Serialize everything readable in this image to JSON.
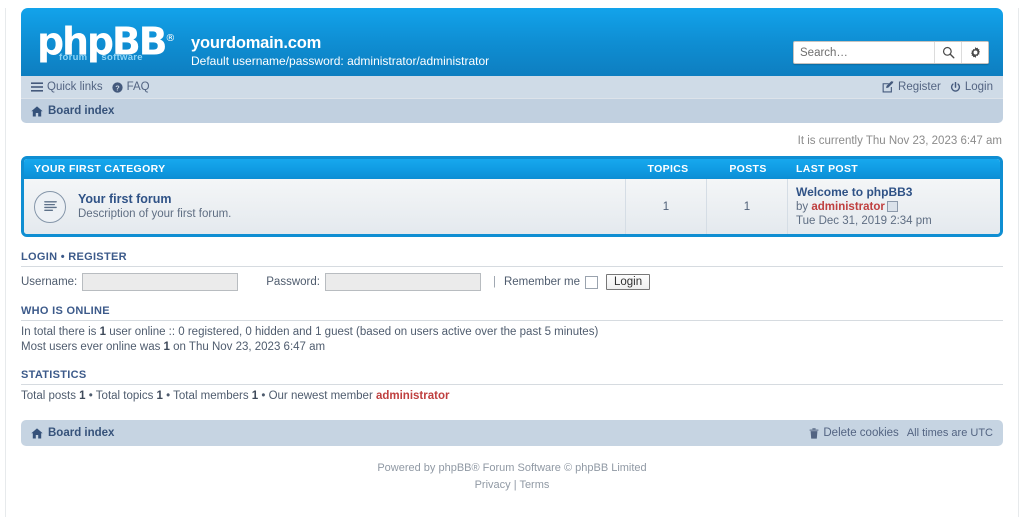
{
  "header": {
    "logo_text": "phpBB",
    "logo_sub_left": "forum",
    "logo_sub_right": "software",
    "site_title": "yourdomain.com",
    "site_description": "Default username/password: administrator/administrator"
  },
  "search": {
    "placeholder": "Search…",
    "search_icon": "search-icon",
    "advanced_icon": "gear-icon"
  },
  "navbar": {
    "quick_links": "Quick links",
    "faq": "FAQ",
    "register": "Register",
    "login": "Login",
    "board_index": "Board index"
  },
  "time_notice": "It is currently Thu Nov 23, 2023 6:47 am",
  "forum_table": {
    "columns": {
      "category": "YOUR FIRST CATEGORY",
      "topics": "TOPICS",
      "posts": "POSTS",
      "last_post": "LAST POST"
    },
    "rows": [
      {
        "name": "Your first forum",
        "description": "Description of your first forum.",
        "topics": "1",
        "posts": "1",
        "last_post_title": "Welcome to phpBB3",
        "last_post_by_label": "by",
        "last_post_author": "administrator",
        "last_post_date": "Tue Dec 31, 2019 2:34 pm"
      }
    ]
  },
  "login_section": {
    "heading_login": "LOGIN",
    "heading_sep": "•",
    "heading_register": "REGISTER",
    "username_label": "Username:",
    "username_value": "",
    "password_label": "Password:",
    "password_value": "",
    "pipe": "|",
    "remember_label": "Remember me",
    "login_button": "Login"
  },
  "who_is_online": {
    "heading": "WHO IS ONLINE",
    "line1_a": "In total there is ",
    "line1_b": "1",
    "line1_c": " user online :: 0 registered, 0 hidden and 1 guest (based on users active over the past 5 minutes)",
    "line2_a": "Most users ever online was ",
    "line2_b": "1",
    "line2_c": " on Thu Nov 23, 2023 6:47 am"
  },
  "statistics": {
    "heading": "STATISTICS",
    "total_posts_label": "Total posts ",
    "total_posts": "1",
    "sep1": " • ",
    "total_topics_label": "Total topics ",
    "total_topics": "1",
    "sep2": " • ",
    "total_members_label": "Total members ",
    "total_members": "1",
    "sep3": " • ",
    "newest_member_label": "Our newest member ",
    "newest_member": "administrator"
  },
  "footer": {
    "board_index": "Board index",
    "delete_cookies": "Delete cookies",
    "timezone": "All times are UTC",
    "powered_by_pre": "Powered by ",
    "powered_by_brand": "phpBB",
    "powered_by_post": "® Forum Software © phpBB Limited",
    "privacy": "Privacy",
    "divider": "|",
    "terms": "Terms"
  },
  "colors": {
    "header_blue": "#0f8fd4",
    "category_blue": "#109ce4",
    "nav_bg": "#cfdbe7",
    "link_blue": "#2f5286",
    "author_red": "#bf3f3f"
  }
}
